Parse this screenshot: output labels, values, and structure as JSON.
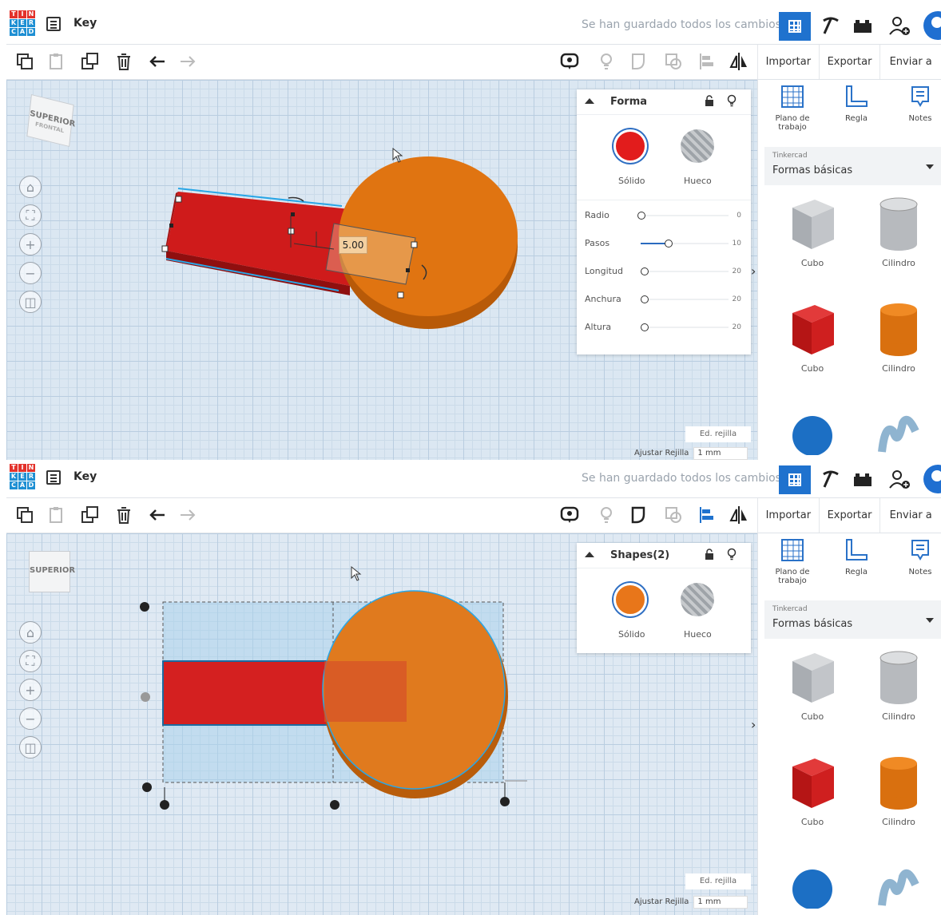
{
  "frames": [
    {
      "title": "Key",
      "save_status": "Se han guardado todos los cambios.",
      "toolbar_right": [
        "Importar",
        "Exportar",
        "Enviar a"
      ],
      "viewcube": {
        "top": "SUPERIOR",
        "front": "FRONTAL"
      },
      "inspector": {
        "title": "Forma",
        "solid_label": "Sólido",
        "hole_label": "Hueco",
        "solid_color": "#e21c1c",
        "properties": [
          {
            "label": "Radio",
            "value": "0",
            "level": 0.0
          },
          {
            "label": "Pasos",
            "value": "10",
            "level": 0.3
          },
          {
            "label": "Longitud",
            "value": "20",
            "level": 0.0
          },
          {
            "label": "Anchura",
            "value": "20",
            "level": 0.0
          },
          {
            "label": "Altura",
            "value": "20",
            "level": 0.0
          }
        ]
      },
      "dimension_label": "5.00",
      "library": {
        "tools": [
          "Plano de trabajo",
          "Regla",
          "Notes"
        ],
        "source_small": "Tinkercad",
        "source": "Formas básicas",
        "shapes": [
          "Cubo",
          "Cilindro",
          "Cubo",
          "Cilindro"
        ]
      },
      "grid_edit": "Ed. rejilla",
      "snap_label": "Ajustar Rejilla",
      "snap_value": "1 mm"
    },
    {
      "title": "Key",
      "save_status": "Se han guardado todos los cambios.",
      "toolbar_right": [
        "Importar",
        "Exportar",
        "Enviar a"
      ],
      "viewcube": {
        "top": "SUPERIOR",
        "front": ""
      },
      "inspector": {
        "title": "Shapes(2)",
        "solid_label": "Sólido",
        "hole_label": "Hueco",
        "solid_color": "#e8761a",
        "properties": []
      },
      "dimension_label": "",
      "library": {
        "tools": [
          "Plano de trabajo",
          "Regla",
          "Notes"
        ],
        "source_small": "Tinkercad",
        "source": "Formas básicas",
        "shapes": [
          "Cubo",
          "Cilindro",
          "Cubo",
          "Cilindro"
        ]
      },
      "grid_edit": "Ed. rejilla",
      "snap_label": "Ajustar Rejilla",
      "snap_value": "1 mm"
    }
  ],
  "colors": {
    "accent": "#1f72ce",
    "red_shape": "#d42020",
    "orange_shape": "#e0700f"
  },
  "icons": [
    "grid-view-icon",
    "pickaxe-icon",
    "bricks-icon",
    "add-user-icon",
    "copy-icon",
    "paste-icon",
    "duplicate-icon",
    "trash-icon",
    "undo-icon",
    "redo-icon",
    "speech-bubble-icon",
    "bulb-icon",
    "group-icon",
    "ungroup-icon",
    "align-icon",
    "mirror-icon"
  ]
}
